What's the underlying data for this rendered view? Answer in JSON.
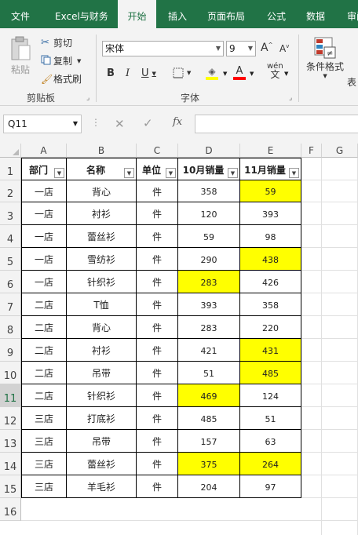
{
  "tabs": [
    "文件",
    "Excel与财务",
    "开始",
    "插入",
    "页面布局",
    "公式",
    "数据",
    "审阅"
  ],
  "active_tab": "开始",
  "clipboard": {
    "paste": "粘贴",
    "cut": "剪切",
    "copy": "复制",
    "format_painter": "格式刷",
    "group": "剪贴板"
  },
  "font": {
    "name": "宋体",
    "size": "9",
    "group": "字体",
    "bold": "B",
    "italic": "I",
    "underline": "U",
    "wen": "wén",
    "wen2": "文"
  },
  "styles": {
    "conditional_format": "条件格式",
    "table_format_partial": "表"
  },
  "formula_bar": {
    "name_box": "Q11",
    "fx": "fx",
    "formula": ""
  },
  "columns": [
    "A",
    "B",
    "C",
    "D",
    "E",
    "F",
    "G"
  ],
  "headers": [
    "部门",
    "名称",
    "单位",
    "10月销量",
    "11月销量"
  ],
  "rows": [
    {
      "n": "1"
    },
    {
      "n": "2",
      "c": [
        "一店",
        "背心",
        "件",
        "358",
        "59"
      ],
      "hl": [
        false,
        true
      ]
    },
    {
      "n": "3",
      "c": [
        "一店",
        "衬衫",
        "件",
        "120",
        "393"
      ],
      "hl": [
        false,
        false
      ]
    },
    {
      "n": "4",
      "c": [
        "一店",
        "蕾丝衫",
        "件",
        "59",
        "98"
      ],
      "hl": [
        false,
        false
      ]
    },
    {
      "n": "5",
      "c": [
        "一店",
        "雪纺衫",
        "件",
        "290",
        "438"
      ],
      "hl": [
        false,
        true
      ]
    },
    {
      "n": "6",
      "c": [
        "一店",
        "针织衫",
        "件",
        "283",
        "426"
      ],
      "hl": [
        true,
        false
      ]
    },
    {
      "n": "7",
      "c": [
        "二店",
        "T恤",
        "件",
        "393",
        "358"
      ],
      "hl": [
        false,
        false
      ]
    },
    {
      "n": "8",
      "c": [
        "二店",
        "背心",
        "件",
        "283",
        "220"
      ],
      "hl": [
        false,
        false
      ]
    },
    {
      "n": "9",
      "c": [
        "二店",
        "衬衫",
        "件",
        "421",
        "431"
      ],
      "hl": [
        false,
        true
      ]
    },
    {
      "n": "10",
      "c": [
        "二店",
        "吊带",
        "件",
        "51",
        "485"
      ],
      "hl": [
        false,
        true
      ]
    },
    {
      "n": "11",
      "c": [
        "二店",
        "针织衫",
        "件",
        "469",
        "124"
      ],
      "hl": [
        true,
        false
      ]
    },
    {
      "n": "12",
      "c": [
        "三店",
        "打底衫",
        "件",
        "485",
        "51"
      ],
      "hl": [
        false,
        false
      ]
    },
    {
      "n": "13",
      "c": [
        "三店",
        "吊带",
        "件",
        "157",
        "63"
      ],
      "hl": [
        false,
        false
      ]
    },
    {
      "n": "14",
      "c": [
        "三店",
        "蕾丝衫",
        "件",
        "375",
        "264"
      ],
      "hl": [
        true,
        true
      ]
    },
    {
      "n": "15",
      "c": [
        "三店",
        "羊毛衫",
        "件",
        "204",
        "97"
      ],
      "hl": [
        false,
        false
      ]
    },
    {
      "n": "16"
    }
  ],
  "colors": {
    "excel_green": "#217346",
    "highlight": "#ffff00",
    "font_color": "#ff0000"
  }
}
